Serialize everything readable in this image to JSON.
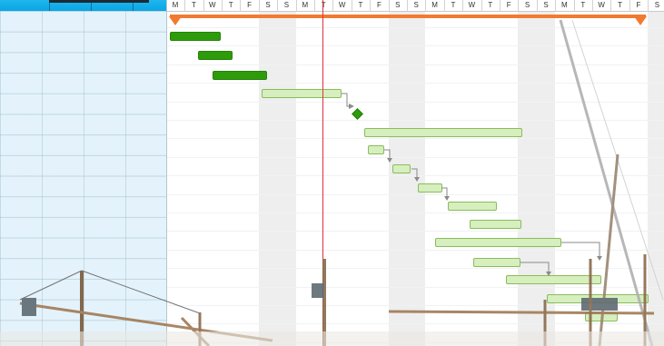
{
  "timeline": {
    "days": [
      "M",
      "T",
      "W",
      "T",
      "F",
      "S",
      "S",
      "M",
      "T",
      "W",
      "T",
      "F",
      "S",
      "S",
      "M",
      "T",
      "W",
      "T",
      "F",
      "S",
      "S",
      "M",
      "T",
      "W",
      "T",
      "F",
      "S"
    ]
  },
  "colors": {
    "summary": "#f27a30",
    "leaf_task": "#2e9b0c",
    "task": "#d7eebf",
    "today": "#e0303a",
    "grid_header": "#0aa6e4",
    "grid_background": "#e4f3fb"
  },
  "icons": [
    "summary-start-marker",
    "summary-end-marker",
    "milestone-diamond",
    "dependency-arrow"
  ]
}
